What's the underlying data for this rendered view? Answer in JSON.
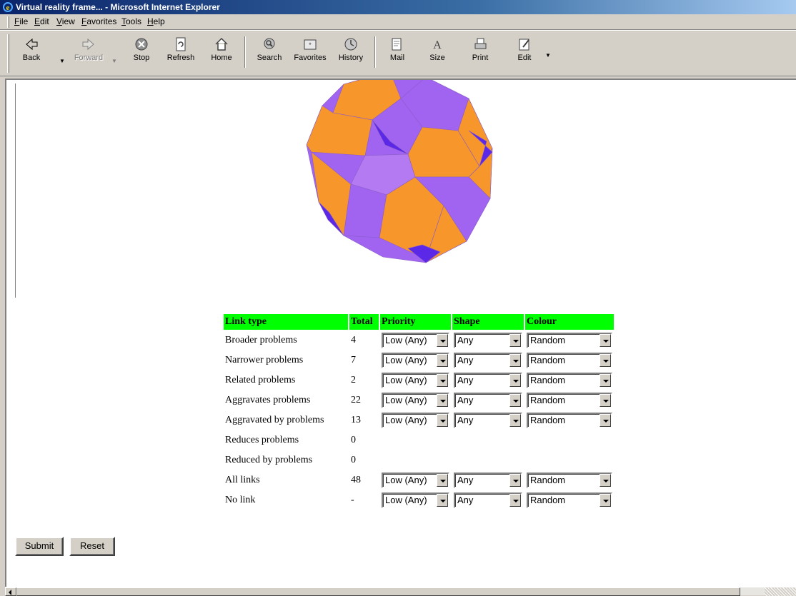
{
  "window": {
    "title": "Virtual reality frame... - Microsoft Internet Explorer"
  },
  "menu": [
    "File",
    "Edit",
    "View",
    "Favorites",
    "Tools",
    "Help"
  ],
  "toolbar": {
    "back": "Back",
    "forward": "Forward",
    "stop": "Stop",
    "refresh": "Refresh",
    "home": "Home",
    "search": "Search",
    "favorites": "Favorites",
    "history": "History",
    "mail": "Mail",
    "size": "Size",
    "print": "Print",
    "edit": "Edit"
  },
  "table": {
    "headers": {
      "link_type": "Link type",
      "total": "Total",
      "priority": "Priority",
      "shape": "Shape",
      "colour": "Colour"
    },
    "rows": [
      {
        "type": "Broader problems",
        "total": "4",
        "priority": "Low (Any)",
        "shape": "Any",
        "colour": "Random"
      },
      {
        "type": "Narrower problems",
        "total": "7",
        "priority": "Low (Any)",
        "shape": "Any",
        "colour": "Random"
      },
      {
        "type": "Related problems",
        "total": "2",
        "priority": "Low (Any)",
        "shape": "Any",
        "colour": "Random"
      },
      {
        "type": "Aggravates problems",
        "total": "22",
        "priority": "Low (Any)",
        "shape": "Any",
        "colour": "Random"
      },
      {
        "type": "Aggravated by problems",
        "total": "13",
        "priority": "Low (Any)",
        "shape": "Any",
        "colour": "Random"
      },
      {
        "type": "Reduces problems",
        "total": "0"
      },
      {
        "type": "Reduced by problems",
        "total": "0"
      },
      {
        "type": "All links",
        "total": "48",
        "priority": "Low (Any)",
        "shape": "Any",
        "colour": "Random"
      },
      {
        "type": "No link",
        "total": "-",
        "priority": "Low (Any)",
        "shape": "Any",
        "colour": "Random"
      }
    ]
  },
  "buttons": {
    "submit": "Submit",
    "reset": "Reset"
  },
  "colors": {
    "polyhedron_orange": "#f7962a",
    "polyhedron_purple": "#a064f0",
    "polyhedron_blue": "#5a28e6",
    "header_green": "#00ff00"
  }
}
